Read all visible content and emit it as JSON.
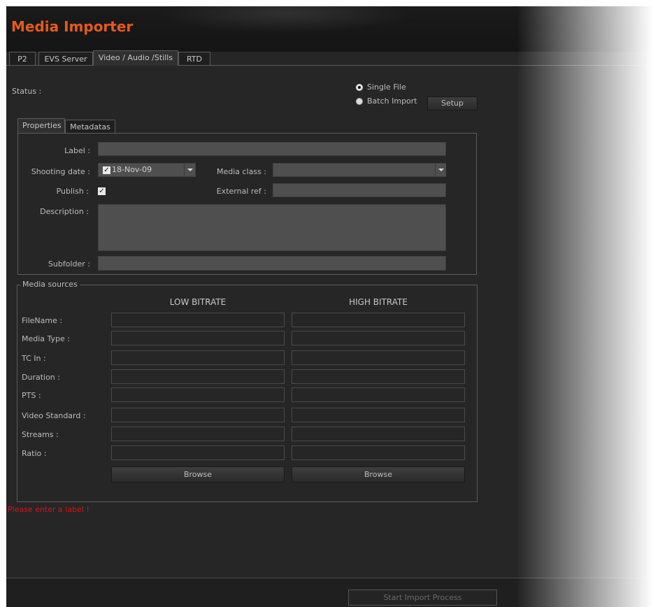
{
  "app": {
    "title": "Media Importer"
  },
  "tabs": [
    "P2",
    "EVS Server",
    "Video / Audio /Stills",
    "RTD"
  ],
  "status": {
    "label": "Status :"
  },
  "mode": {
    "single_file": "Single File",
    "batch_import": "Batch Import",
    "setup": "Setup",
    "selected": "Single File"
  },
  "subtabs": [
    "Properties",
    "Metadatas"
  ],
  "properties": {
    "label_label": "Label :",
    "label_value": "",
    "shooting_date_label": "Shooting date :",
    "shooting_date_value": "18-Nov-09",
    "shooting_date_checked": true,
    "media_class_label": "Media class :",
    "media_class_value": "",
    "publish_label": "Publish :",
    "publish_checked": true,
    "external_ref_label": "External ref :",
    "external_ref_value": "",
    "description_label": "Description :",
    "description_value": "",
    "subfolder_label": "Subfolder :",
    "subfolder_value": ""
  },
  "media_sources": {
    "legend": "Media sources",
    "low_header": "LOW BITRATE",
    "high_header": "HIGH BITRATE",
    "rows": [
      "FileName :",
      "Media Type :",
      "TC In :",
      "Duration :",
      "PTS :",
      "Video Standard :",
      "Streams :",
      "Ratio :"
    ],
    "browse_label": "Browse"
  },
  "error": {
    "message": "Please enter a label !"
  },
  "footer": {
    "start_label": "Start Import Process"
  },
  "colors": {
    "title": "#e55a19",
    "error": "#e01010",
    "background": "#262626"
  }
}
